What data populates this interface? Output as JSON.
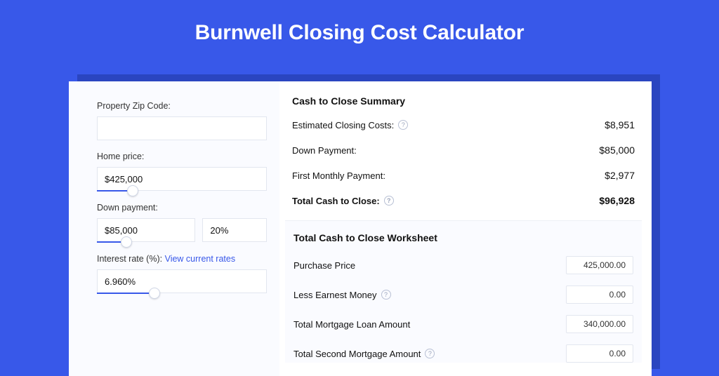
{
  "page": {
    "title": "Burnwell Closing Cost Calculator"
  },
  "inputs": {
    "zip_label": "Property Zip Code:",
    "zip_value": "",
    "home_price_label": "Home price:",
    "home_price_value": "$425,000",
    "down_payment_label": "Down payment:",
    "down_payment_value": "$85,000",
    "down_payment_pct": "20%",
    "interest_rate_label": "Interest rate (%):",
    "interest_rate_link": "View current rates",
    "interest_rate_value": "6.960%"
  },
  "summary": {
    "title": "Cash to Close Summary",
    "rows": [
      {
        "label": "Estimated Closing Costs:",
        "help": true,
        "value": "$8,951"
      },
      {
        "label": "Down Payment:",
        "help": false,
        "value": "$85,000"
      },
      {
        "label": "First Monthly Payment:",
        "help": false,
        "value": "$2,977"
      }
    ],
    "total": {
      "label": "Total Cash to Close:",
      "help": true,
      "value": "$96,928"
    }
  },
  "worksheet": {
    "title": "Total Cash to Close Worksheet",
    "rows": [
      {
        "label": "Purchase Price",
        "help": false,
        "value": "425,000.00"
      },
      {
        "label": "Less Earnest Money",
        "help": true,
        "value": "0.00"
      },
      {
        "label": "Total Mortgage Loan Amount",
        "help": false,
        "value": "340,000.00"
      },
      {
        "label": "Total Second Mortgage Amount",
        "help": true,
        "value": "0.00"
      }
    ]
  },
  "sliders": {
    "home_price_pos_pct": 21,
    "down_payment_pos_pct": 28,
    "interest_rate_pos_pct": 34
  }
}
